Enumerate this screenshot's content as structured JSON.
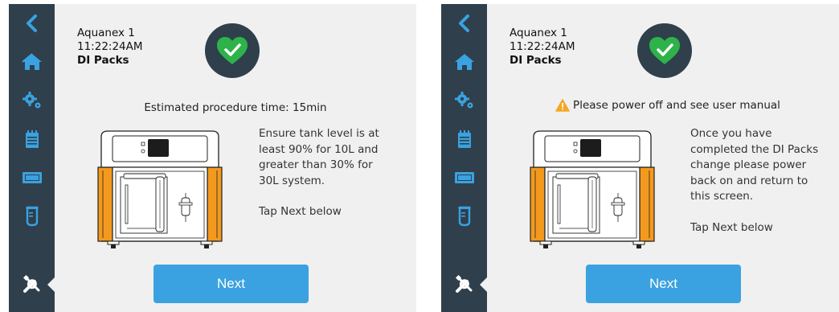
{
  "screens": [
    {
      "device_name": "Aquanex 1",
      "time": "11:22:24AM",
      "section": "DI Packs",
      "status_icon": "heart-check-icon",
      "notice": "Estimated procedure time: 15min",
      "instructions": "Ensure tank level is at least 90% for 10L and greater than 30% for 30L system.",
      "tap_hint": "Tap Next below",
      "next_label": "Next"
    },
    {
      "device_name": "Aquanex 1",
      "time": "11:22:24AM",
      "section": "DI Packs",
      "status_icon": "heart-check-icon",
      "notice": "Please power off and see user manual",
      "notice_icon": "warning-icon",
      "instructions": "Once you have completed the DI Packs change please power back on and return to this screen.",
      "tap_hint": "Tap Next below",
      "next_label": "Next"
    }
  ],
  "sidebar": {
    "items": [
      "back-icon",
      "home-icon",
      "settings-gears-icon",
      "calendar-icon",
      "display-icon",
      "tank-icon",
      "tools-icon"
    ],
    "active": "tools-icon"
  },
  "colors": {
    "sidebar": "#2f3f4c",
    "accent": "#3aa2e0",
    "status_ok": "#2db34a",
    "warning": "#f5a623",
    "device_orange": "#f39a1e"
  }
}
